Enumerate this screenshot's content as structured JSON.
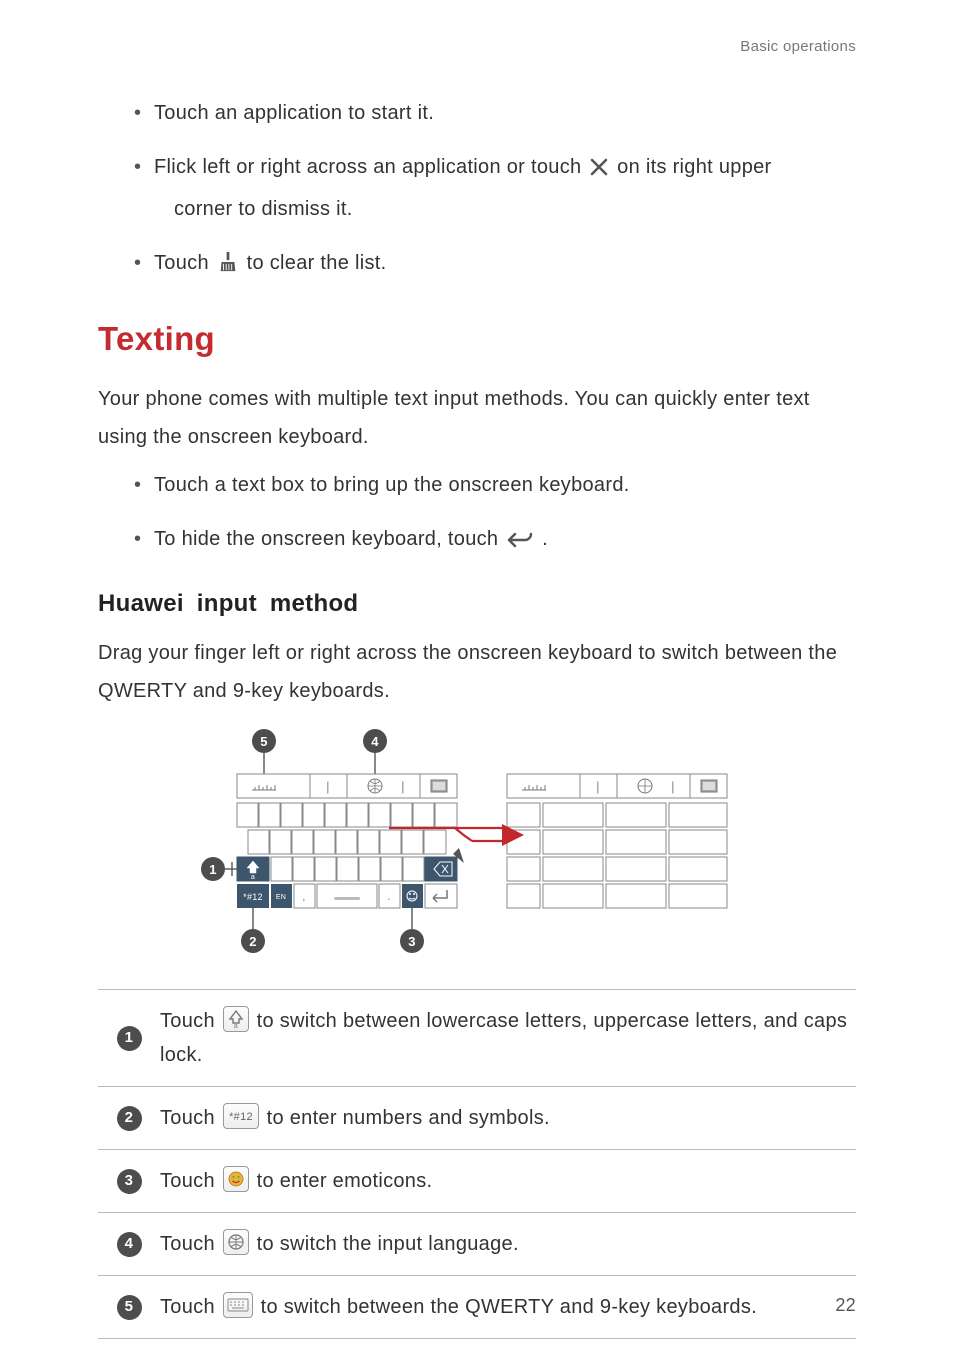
{
  "header": {
    "section": "Basic operations"
  },
  "bullets_top": {
    "b1": "Touch an application to start it.",
    "b2_a": "Flick left or right across an application or touch ",
    "b2_b": " on its right upper",
    "b2_c": "corner to dismiss it.",
    "b3_a": "Touch ",
    "b3_b": " to clear the list."
  },
  "texting": {
    "heading": "Texting",
    "intro": "Your phone comes with multiple text input methods. You can quickly enter text using the onscreen keyboard.",
    "b1": "Touch a text box to bring up the onscreen keyboard.",
    "b2_a": "To hide the onscreen keyboard, touch ",
    "b2_b": "."
  },
  "huawei": {
    "heading": "Huawei  input  method",
    "intro": "Drag your finger left or right across the onscreen keyboard to switch between the QWERTY and 9-key keyboards."
  },
  "legend": {
    "r1_a": "Touch ",
    "r1_b": " to switch between lowercase letters, uppercase letters, and caps lock.",
    "r2_a": "Touch ",
    "r2_b": " to enter numbers and symbols.",
    "r3_a": "Touch ",
    "r3_b": " to enter emoticons.",
    "r4_a": "Touch ",
    "r4_b": " to switch the input language.",
    "r5_a": "Touch ",
    "r5_b": " to switch between the QWERTY and 9-key keyboards."
  },
  "diagram_labels": {
    "l1": "1",
    "l2": "2",
    "l3": "3",
    "l4": "4",
    "l5": "5"
  },
  "key_labels": {
    "shift_sub": "a",
    "numsym": "*#12",
    "lang": "EN"
  },
  "page_number": "22"
}
